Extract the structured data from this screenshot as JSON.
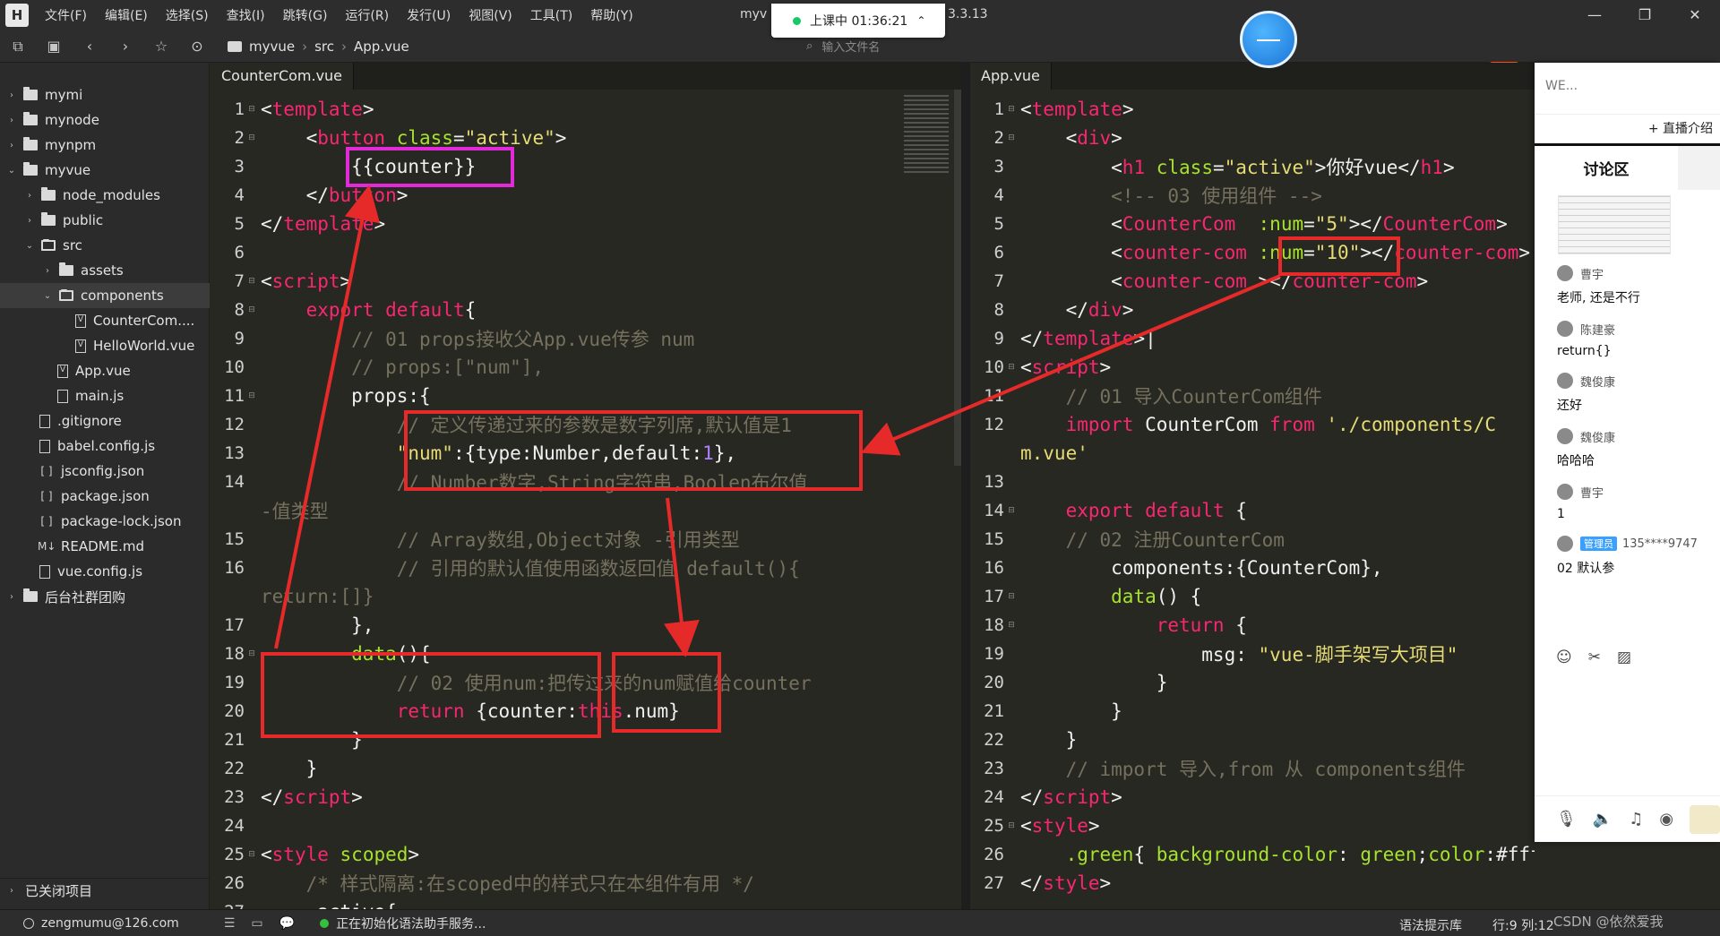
{
  "menu": [
    "文件(F)",
    "编辑(E)",
    "选择(S)",
    "查找(I)",
    "跳转(G)",
    "运行(R)",
    "发行(U)",
    "视图(V)",
    "工具(T)",
    "帮助(Y)"
  ],
  "window_title": "myv",
  "window_version": "3.3.13",
  "live": {
    "label": "上课中 01:36:21"
  },
  "breadcrumb": [
    "myvue",
    "src",
    "App.vue"
  ],
  "file_search_placeholder": "输入文件名",
  "sidebar": {
    "items": [
      {
        "label": "mymi",
        "type": "folder",
        "depth": 0,
        "expanded": false
      },
      {
        "label": "mynode",
        "type": "folder",
        "depth": 0,
        "expanded": false
      },
      {
        "label": "mynpm",
        "type": "folder",
        "depth": 0,
        "expanded": false
      },
      {
        "label": "myvue",
        "type": "folder",
        "depth": 0,
        "expanded": true
      },
      {
        "label": "node_modules",
        "type": "folder",
        "depth": 1,
        "expanded": false
      },
      {
        "label": "public",
        "type": "folder",
        "depth": 1,
        "expanded": false
      },
      {
        "label": "src",
        "type": "folder",
        "depth": 1,
        "expanded": true
      },
      {
        "label": "assets",
        "type": "folder",
        "depth": 2,
        "expanded": false
      },
      {
        "label": "components",
        "type": "folder",
        "depth": 2,
        "expanded": true,
        "selected": true
      },
      {
        "label": "CounterCom....",
        "type": "vue",
        "depth": 3
      },
      {
        "label": "HelloWorld.vue",
        "type": "vue",
        "depth": 3
      },
      {
        "label": "App.vue",
        "type": "vue",
        "depth": 2
      },
      {
        "label": "main.js",
        "type": "js",
        "depth": 2
      },
      {
        "label": ".gitignore",
        "type": "file",
        "depth": 1
      },
      {
        "label": "babel.config.js",
        "type": "js",
        "depth": 1
      },
      {
        "label": "jsconfig.json",
        "type": "json",
        "depth": 1
      },
      {
        "label": "package.json",
        "type": "json",
        "depth": 1
      },
      {
        "label": "package-lock.json",
        "type": "json",
        "depth": 1
      },
      {
        "label": "README.md",
        "type": "md",
        "depth": 1
      },
      {
        "label": "vue.config.js",
        "type": "js",
        "depth": 1
      },
      {
        "label": "后台社群团购",
        "type": "folder",
        "depth": 0,
        "expanded": false
      }
    ],
    "closed_projects": "已关闭项目"
  },
  "left_editor": {
    "tab": "CounterCom.vue",
    "lines": [
      {
        "n": "1",
        "fold": "⊟",
        "segs": [
          [
            "t",
            "<"
          ],
          [
            "tag",
            "template"
          ],
          [
            "t",
            ">"
          ]
        ]
      },
      {
        "n": "2",
        "fold": "⊟",
        "segs": [
          [
            "t",
            "    <"
          ],
          [
            "tag",
            "button"
          ],
          [
            "t",
            " "
          ],
          [
            "attr",
            "class"
          ],
          [
            "t",
            "="
          ],
          [
            "str",
            "\"active\""
          ],
          [
            "t",
            ">"
          ]
        ]
      },
      {
        "n": "3",
        "fold": "",
        "segs": [
          [
            "t",
            "        {{counter}}"
          ]
        ]
      },
      {
        "n": "4",
        "fold": "",
        "segs": [
          [
            "t",
            "    </"
          ],
          [
            "tag",
            "button"
          ],
          [
            "t",
            ">"
          ]
        ]
      },
      {
        "n": "5",
        "fold": "",
        "segs": [
          [
            "t",
            "</"
          ],
          [
            "tag",
            "template"
          ],
          [
            "t",
            ">"
          ]
        ]
      },
      {
        "n": "6",
        "fold": "",
        "segs": [
          [
            "t",
            ""
          ]
        ]
      },
      {
        "n": "7",
        "fold": "⊟",
        "segs": [
          [
            "t",
            "<"
          ],
          [
            "tag",
            "script"
          ],
          [
            "t",
            ">"
          ]
        ]
      },
      {
        "n": "8",
        "fold": "⊟",
        "segs": [
          [
            "t",
            "    "
          ],
          [
            "kw",
            "export default"
          ],
          [
            "t",
            "{"
          ]
        ]
      },
      {
        "n": "9",
        "fold": "",
        "segs": [
          [
            "cm",
            "        // 01 props接收父App.vue传参 num"
          ]
        ]
      },
      {
        "n": "10",
        "fold": "",
        "segs": [
          [
            "cm",
            "        // props:[\"num\"],"
          ]
        ]
      },
      {
        "n": "11",
        "fold": "⊟",
        "segs": [
          [
            "t",
            "        props:{"
          ]
        ]
      },
      {
        "n": "12",
        "fold": "",
        "segs": [
          [
            "cm",
            "            // 定义传递过来的参数是数字列席,默认值是1"
          ]
        ]
      },
      {
        "n": "13",
        "fold": "",
        "segs": [
          [
            "str",
            "            \"num\""
          ],
          [
            "t",
            ":{type:Number,default:"
          ],
          [
            "num",
            "1"
          ],
          [
            "t",
            "},"
          ]
        ]
      },
      {
        "n": "14",
        "fold": "",
        "segs": [
          [
            "cm",
            "            // Number数字,String字符串,Boolen布尔值"
          ]
        ]
      },
      {
        "n": "",
        "fold": "",
        "segs": [
          [
            "cm",
            "-值类型"
          ]
        ]
      },
      {
        "n": "15",
        "fold": "",
        "segs": [
          [
            "cm",
            "            // Array数组,Object对象 -引用类型"
          ]
        ]
      },
      {
        "n": "16",
        "fold": "",
        "segs": [
          [
            "cm",
            "            // 引用的默认值使用函数返回值 default(){"
          ]
        ]
      },
      {
        "n": "",
        "fold": "",
        "segs": [
          [
            "cm",
            "return:[]}"
          ]
        ]
      },
      {
        "n": "17",
        "fold": "",
        "segs": [
          [
            "t",
            "        },"
          ]
        ]
      },
      {
        "n": "18",
        "fold": "⊟",
        "segs": [
          [
            "t",
            "        "
          ],
          [
            "fn",
            "data"
          ],
          [
            "t",
            "(){"
          ]
        ]
      },
      {
        "n": "19",
        "fold": "",
        "segs": [
          [
            "cm",
            "            // 02 使用num:把传过来的num赋值给counter"
          ]
        ]
      },
      {
        "n": "20",
        "fold": "",
        "segs": [
          [
            "t",
            "            "
          ],
          [
            "kw",
            "return"
          ],
          [
            "t",
            " {counter:"
          ],
          [
            "kw",
            "this"
          ],
          [
            "t",
            ".num}"
          ]
        ]
      },
      {
        "n": "21",
        "fold": "",
        "segs": [
          [
            "t",
            "        }"
          ]
        ]
      },
      {
        "n": "22",
        "fold": "",
        "segs": [
          [
            "t",
            "    }"
          ]
        ]
      },
      {
        "n": "23",
        "fold": "",
        "segs": [
          [
            "t",
            "</"
          ],
          [
            "tag",
            "script"
          ],
          [
            "t",
            ">"
          ]
        ]
      },
      {
        "n": "24",
        "fold": "",
        "segs": [
          [
            "t",
            ""
          ]
        ]
      },
      {
        "n": "25",
        "fold": "⊟",
        "segs": [
          [
            "t",
            "<"
          ],
          [
            "tag",
            "style"
          ],
          [
            "t",
            " "
          ],
          [
            "attr",
            "scoped"
          ],
          [
            "t",
            ">"
          ]
        ]
      },
      {
        "n": "26",
        "fold": "",
        "segs": [
          [
            "cm",
            "    /* 样式隔离:在scoped中的样式只在本组件有用 */"
          ]
        ]
      },
      {
        "n": "27",
        "fold": "",
        "segs": [
          [
            "t",
            "    .active{"
          ]
        ]
      }
    ]
  },
  "right_editor": {
    "tab": "App.vue",
    "lines": [
      {
        "n": "1",
        "fold": "⊟",
        "segs": [
          [
            "t",
            "<"
          ],
          [
            "tag",
            "template"
          ],
          [
            "t",
            ">"
          ]
        ]
      },
      {
        "n": "2",
        "fold": "⊟",
        "segs": [
          [
            "t",
            "    <"
          ],
          [
            "tag",
            "div"
          ],
          [
            "t",
            ">"
          ]
        ]
      },
      {
        "n": "3",
        "fold": "",
        "segs": [
          [
            "t",
            "        <"
          ],
          [
            "tag",
            "h1"
          ],
          [
            "t",
            " "
          ],
          [
            "attr",
            "class"
          ],
          [
            "t",
            "="
          ],
          [
            "str",
            "\"active\""
          ],
          [
            "t",
            ">你好vue</"
          ],
          [
            "tag",
            "h1"
          ],
          [
            "t",
            ">"
          ]
        ]
      },
      {
        "n": "4",
        "fold": "",
        "segs": [
          [
            "cm",
            "        <!-- 03 使用组件 -->"
          ]
        ]
      },
      {
        "n": "5",
        "fold": "",
        "segs": [
          [
            "t",
            "        <"
          ],
          [
            "tag",
            "CounterCom"
          ],
          [
            "t",
            "  "
          ],
          [
            "attr",
            ":num"
          ],
          [
            "t",
            "="
          ],
          [
            "str",
            "\"5\""
          ],
          [
            "t",
            "></"
          ],
          [
            "tag",
            "CounterCom"
          ],
          [
            "t",
            ">"
          ]
        ]
      },
      {
        "n": "6",
        "fold": "",
        "segs": [
          [
            "t",
            "        <"
          ],
          [
            "tag",
            "counter-com"
          ],
          [
            "t",
            " "
          ],
          [
            "attr",
            ":num"
          ],
          [
            "t",
            "="
          ],
          [
            "str",
            "\"10\""
          ],
          [
            "t",
            "></"
          ],
          [
            "tag",
            "counter-com"
          ],
          [
            "t",
            ">"
          ]
        ]
      },
      {
        "n": "7",
        "fold": "",
        "segs": [
          [
            "t",
            "        <"
          ],
          [
            "tag",
            "counter-com"
          ],
          [
            "t",
            " ></"
          ],
          [
            "tag",
            "counter-com"
          ],
          [
            "t",
            ">"
          ]
        ]
      },
      {
        "n": "8",
        "fold": "",
        "segs": [
          [
            "t",
            "    </"
          ],
          [
            "tag",
            "div"
          ],
          [
            "t",
            ">"
          ]
        ]
      },
      {
        "n": "9",
        "fold": "",
        "segs": [
          [
            "t",
            "</"
          ],
          [
            "tag",
            "template"
          ],
          [
            "t",
            ">|"
          ]
        ]
      },
      {
        "n": "10",
        "fold": "⊟",
        "segs": [
          [
            "t",
            "<"
          ],
          [
            "tag",
            "script"
          ],
          [
            "t",
            ">"
          ]
        ]
      },
      {
        "n": "11",
        "fold": "",
        "segs": [
          [
            "cm",
            "    // 01 导入CounterCom组件"
          ]
        ]
      },
      {
        "n": "12",
        "fold": "",
        "segs": [
          [
            "t",
            "    "
          ],
          [
            "kw",
            "import"
          ],
          [
            "t",
            " CounterCom "
          ],
          [
            "kw",
            "from"
          ],
          [
            "t",
            " "
          ],
          [
            "str",
            "'./components/C"
          ]
        ]
      },
      {
        "n": "",
        "fold": "",
        "segs": [
          [
            "str",
            "m.vue'"
          ]
        ]
      },
      {
        "n": "13",
        "fold": "",
        "segs": [
          [
            "t",
            ""
          ]
        ]
      },
      {
        "n": "14",
        "fold": "⊟",
        "segs": [
          [
            "t",
            "    "
          ],
          [
            "kw",
            "export default"
          ],
          [
            "t",
            " {"
          ]
        ]
      },
      {
        "n": "15",
        "fold": "",
        "segs": [
          [
            "cm",
            "    // 02 注册CounterCom"
          ]
        ]
      },
      {
        "n": "16",
        "fold": "",
        "segs": [
          [
            "t",
            "        components:{CounterCom},"
          ]
        ]
      },
      {
        "n": "17",
        "fold": "⊟",
        "segs": [
          [
            "t",
            "        "
          ],
          [
            "fn",
            "data"
          ],
          [
            "t",
            "() {"
          ]
        ]
      },
      {
        "n": "18",
        "fold": "⊟",
        "segs": [
          [
            "t",
            "            "
          ],
          [
            "kw",
            "return"
          ],
          [
            "t",
            " {"
          ]
        ]
      },
      {
        "n": "19",
        "fold": "",
        "segs": [
          [
            "t",
            "                msg: "
          ],
          [
            "str",
            "\"vue-脚手架写大项目\""
          ]
        ]
      },
      {
        "n": "20",
        "fold": "",
        "segs": [
          [
            "t",
            "            }"
          ]
        ]
      },
      {
        "n": "21",
        "fold": "",
        "segs": [
          [
            "t",
            "        }"
          ]
        ]
      },
      {
        "n": "22",
        "fold": "",
        "segs": [
          [
            "t",
            "    }"
          ]
        ]
      },
      {
        "n": "23",
        "fold": "",
        "segs": [
          [
            "cm",
            "    // import 导入,from 从 components组件"
          ]
        ]
      },
      {
        "n": "24",
        "fold": "",
        "segs": [
          [
            "t",
            "</"
          ],
          [
            "tag",
            "script"
          ],
          [
            "t",
            ">"
          ]
        ]
      },
      {
        "n": "25",
        "fold": "⊟",
        "segs": [
          [
            "t",
            "<"
          ],
          [
            "tag",
            "style"
          ],
          [
            "t",
            ">"
          ]
        ]
      },
      {
        "n": "26",
        "fold": "",
        "segs": [
          [
            "t",
            "    "
          ],
          [
            "attr",
            ".green"
          ],
          [
            "t",
            "{ "
          ],
          [
            "attr",
            "background-color"
          ],
          [
            "t",
            ": "
          ],
          [
            "fn",
            "green"
          ],
          [
            "t",
            ";"
          ],
          [
            "attr",
            "color"
          ],
          [
            "t",
            ":#fff;}"
          ]
        ]
      },
      {
        "n": "27",
        "fold": "",
        "segs": [
          [
            "t",
            "</"
          ],
          [
            "tag",
            "style"
          ],
          [
            "t",
            ">"
          ]
        ]
      }
    ]
  },
  "chat": {
    "title": "WE...",
    "intro_button": "+ 直播介绍",
    "tab": "讨论区",
    "messages": [
      {
        "name": "曹宇",
        "role": "",
        "text": "老师, 还是不行"
      },
      {
        "name": "陈建豪",
        "role": "",
        "text": "return{}"
      },
      {
        "name": "魏俊康",
        "role": "",
        "text": "还好"
      },
      {
        "name": "魏俊康",
        "role": "",
        "text": "哈哈哈"
      },
      {
        "name": "曹宇",
        "role": "",
        "text": "1"
      },
      {
        "name": "135****9747",
        "role": "管理员",
        "text": "02 默认参"
      }
    ]
  },
  "status": {
    "user": "zengmumu@126.com",
    "init": "正在初始化语法助手服务...",
    "hint": "语法提示库",
    "position": "行:9  列:12",
    "watermark": "CSDN @依然爱我"
  },
  "colors": {
    "editor_bg": "#272822",
    "annotation_red": "#e62a2a",
    "annotation_magenta": "#e22ad8",
    "tag": "#f92672",
    "attr": "#a6e22e",
    "string": "#e6db74",
    "comment": "#75715e"
  }
}
